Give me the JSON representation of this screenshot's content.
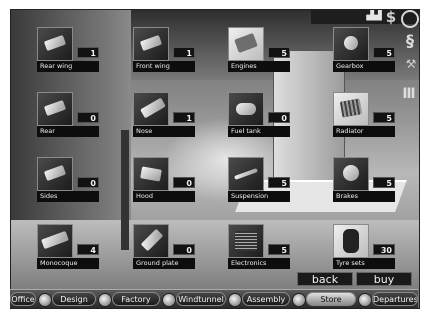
{
  "top_icons": {
    "stairs": "▟▟",
    "money": "$",
    "s": "§",
    "tool": "⚒",
    "pillars": "Ⅲ"
  },
  "parts": [
    {
      "label": "Rear wing",
      "count": "1"
    },
    {
      "label": "Front wing",
      "count": "1"
    },
    {
      "label": "Engines",
      "count": "5"
    },
    {
      "label": "Gearbox",
      "count": "5"
    },
    {
      "label": "Rear",
      "count": "0"
    },
    {
      "label": "Nose",
      "count": "1"
    },
    {
      "label": "Fuel tank",
      "count": "0"
    },
    {
      "label": "Radiator",
      "count": "5"
    },
    {
      "label": "Sides",
      "count": "0"
    },
    {
      "label": "Hood",
      "count": "0"
    },
    {
      "label": "Suspension",
      "count": "5"
    },
    {
      "label": "Brakes",
      "count": "5"
    },
    {
      "label": "Monocoque",
      "count": "4"
    },
    {
      "label": "Ground plate",
      "count": "0"
    },
    {
      "label": "Electronics",
      "count": "5"
    },
    {
      "label": "Tyre sets",
      "count": "30"
    }
  ],
  "buttons": {
    "back": "back",
    "buy": "buy"
  },
  "nav": [
    {
      "label": "Office",
      "active": false
    },
    {
      "label": "Design",
      "active": false
    },
    {
      "label": "Factory",
      "active": false
    },
    {
      "label": "Windtunnel",
      "active": false
    },
    {
      "label": "Assembly",
      "active": false
    },
    {
      "label": "Store",
      "active": true
    },
    {
      "label": "Departures",
      "active": false
    }
  ]
}
